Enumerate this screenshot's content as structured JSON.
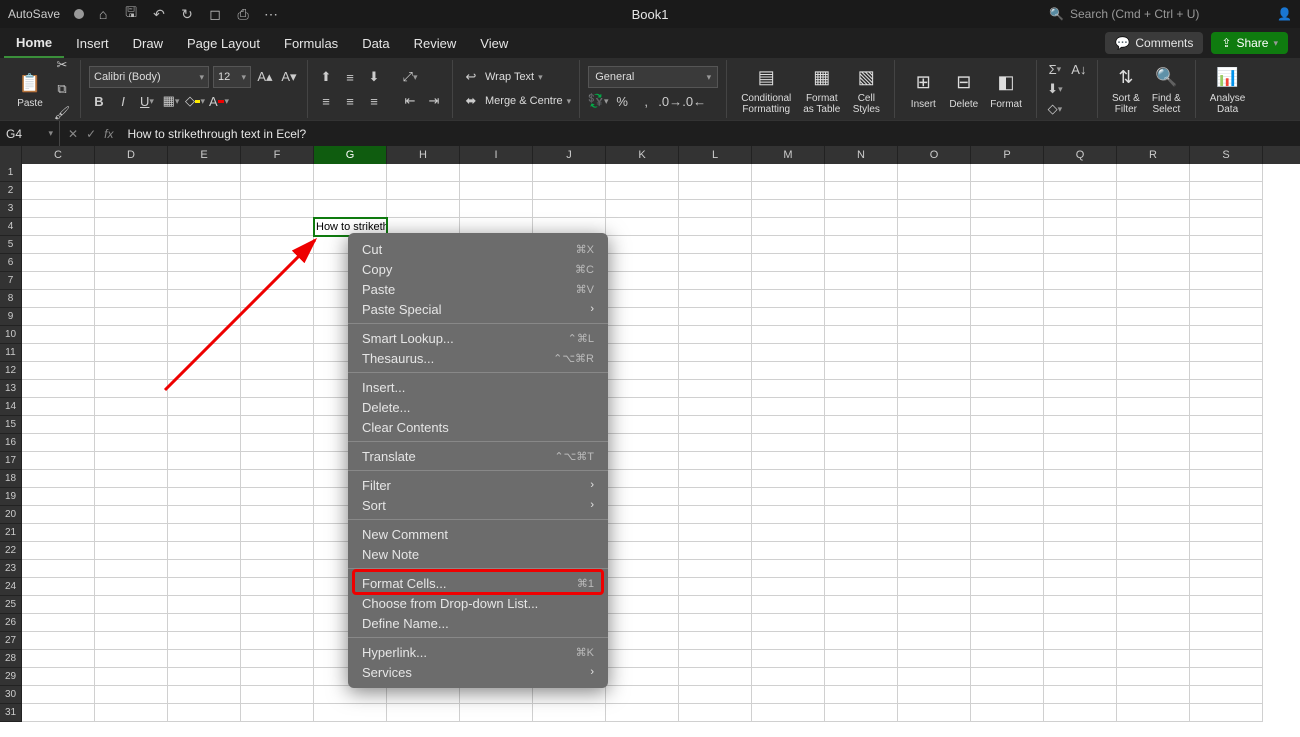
{
  "titlebar": {
    "autosave": "AutoSave",
    "book": "Book1",
    "search_placeholder": "Search (Cmd + Ctrl + U)"
  },
  "tabs": [
    "Home",
    "Insert",
    "Draw",
    "Page Layout",
    "Formulas",
    "Data",
    "Review",
    "View"
  ],
  "tabs_right": {
    "comments": "Comments",
    "share": "Share"
  },
  "ribbon": {
    "paste": "Paste",
    "font_name": "Calibri (Body)",
    "font_size": "12",
    "wrap": "Wrap Text",
    "merge": "Merge & Centre",
    "number_format": "General",
    "cond": "Conditional\nFormatting",
    "astable": "Format\nas Table",
    "cellstyles": "Cell\nStyles",
    "insert": "Insert",
    "delete": "Delete",
    "format": "Format",
    "sortfilter": "Sort &\nFilter",
    "findselect": "Find &\nSelect",
    "analyse": "Analyse\nData"
  },
  "formula_bar": {
    "cellref": "G4",
    "formula": "How to strikethrough text in Ecel?"
  },
  "columns": [
    "C",
    "D",
    "E",
    "F",
    "G",
    "H",
    "I",
    "J",
    "K",
    "L",
    "M",
    "N",
    "O",
    "P",
    "Q",
    "R",
    "S"
  ],
  "selected_column": "G",
  "row_count": 31,
  "active_cell": {
    "row": 4,
    "col": "G",
    "value": "How to strikethrough text in Ecel?"
  },
  "context_menu": {
    "groups": [
      [
        {
          "label": "Cut",
          "shortcut": "⌘X"
        },
        {
          "label": "Copy",
          "shortcut": "⌘C"
        },
        {
          "label": "Paste",
          "shortcut": "⌘V"
        },
        {
          "label": "Paste Special",
          "sub": true
        }
      ],
      [
        {
          "label": "Smart Lookup...",
          "shortcut": "⌃⌘L"
        },
        {
          "label": "Thesaurus...",
          "shortcut": "⌃⌥⌘R"
        }
      ],
      [
        {
          "label": "Insert..."
        },
        {
          "label": "Delete..."
        },
        {
          "label": "Clear Contents"
        }
      ],
      [
        {
          "label": "Translate",
          "shortcut": "⌃⌥⌘T"
        }
      ],
      [
        {
          "label": "Filter",
          "sub": true
        },
        {
          "label": "Sort",
          "sub": true
        }
      ],
      [
        {
          "label": "New Comment"
        },
        {
          "label": "New Note"
        }
      ],
      [
        {
          "label": "Format Cells...",
          "shortcut": "⌘1",
          "highlight": true
        },
        {
          "label": "Choose from Drop-down List..."
        },
        {
          "label": "Define Name..."
        }
      ],
      [
        {
          "label": "Hyperlink...",
          "shortcut": "⌘K"
        },
        {
          "label": "Services",
          "sub": true
        }
      ]
    ]
  }
}
